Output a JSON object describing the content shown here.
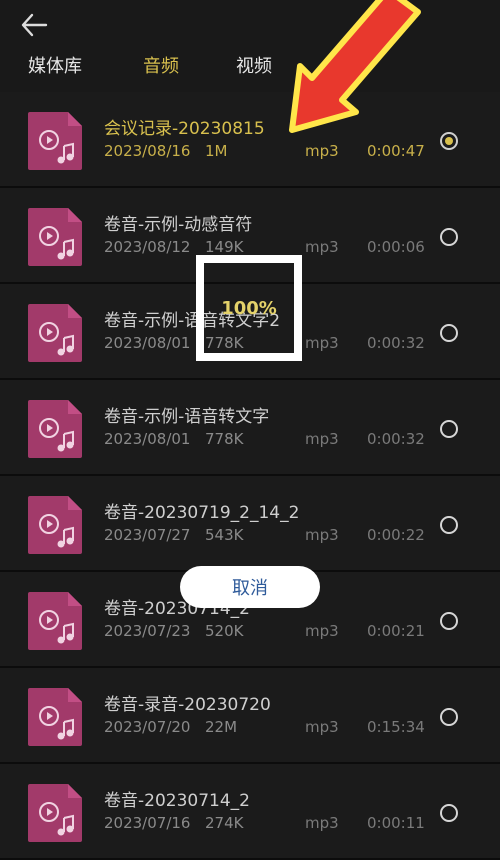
{
  "header": {
    "tabs": [
      {
        "label": "媒体库",
        "active": false
      },
      {
        "label": "音频",
        "active": true
      },
      {
        "label": "视频",
        "active": false
      }
    ]
  },
  "list": {
    "items": [
      {
        "title": "会议记录-20230815",
        "date": "2023/08/16",
        "size": "1M",
        "format": "mp3",
        "duration": "0:00:47",
        "selected": true
      },
      {
        "title": "卷音-示例-动感音符",
        "date": "2023/08/12",
        "size": "149K",
        "format": "mp3",
        "duration": "0:00:06",
        "selected": false
      },
      {
        "title": "卷音-示例-语音转文字2",
        "date": "2023/08/01",
        "size": "778K",
        "format": "mp3",
        "duration": "0:00:32",
        "selected": false
      },
      {
        "title": "卷音-示例-语音转文字",
        "date": "2023/08/01",
        "size": "778K",
        "format": "mp3",
        "duration": "0:00:32",
        "selected": false
      },
      {
        "title": "卷音-20230719_2_14_2",
        "date": "2023/07/27",
        "size": "543K",
        "format": "mp3",
        "duration": "0:00:22",
        "selected": false
      },
      {
        "title": "卷音-20230714_2",
        "date": "2023/07/23",
        "size": "520K",
        "format": "mp3",
        "duration": "0:00:21",
        "selected": false
      },
      {
        "title": "卷音-录音-20230720",
        "date": "2023/07/20",
        "size": "22M",
        "format": "mp3",
        "duration": "0:15:34",
        "selected": false
      },
      {
        "title": "卷音-20230714_2",
        "date": "2023/07/16",
        "size": "274K",
        "format": "mp3",
        "duration": "0:00:11",
        "selected": false
      }
    ]
  },
  "overlay": {
    "progress_text": "100%",
    "cancel_label": "取消"
  },
  "colors": {
    "accent": "#d8c04e",
    "thumb": "#a23a6a",
    "background": "#121212"
  }
}
